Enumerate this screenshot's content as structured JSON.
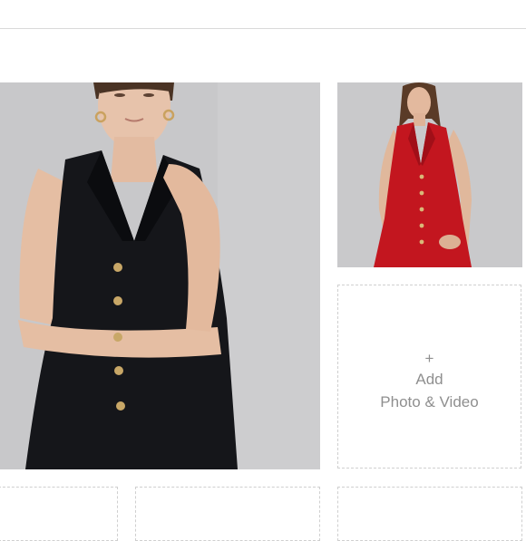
{
  "uploader": {
    "add_tile": {
      "plus": "+",
      "line1": "Add",
      "line2": "Photo & Video",
      "icon": "plus-icon"
    },
    "photos": [
      {
        "subject": "black-sleeveless-vest-dress",
        "selected": true
      },
      {
        "subject": "red-sleeveless-vest-dress",
        "selected": false
      }
    ],
    "empty_slots": 3
  },
  "colors": {
    "background": "#ffffff",
    "divider": "#d9d9d9",
    "dashed_border": "#cfcfcf",
    "label_text": "#8f8f8f",
    "photo_backdrop": "#c9c9cb",
    "dress_black": "#15161a",
    "dress_red": "#c3161f"
  }
}
